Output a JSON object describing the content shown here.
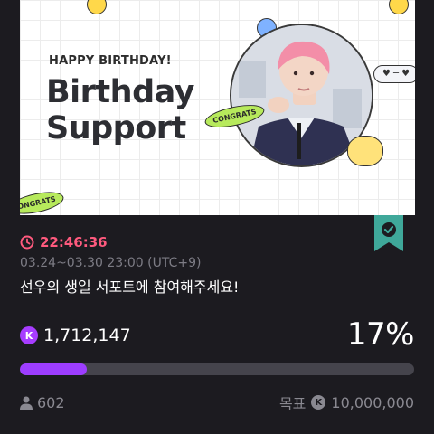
{
  "banner": {
    "greeting": "HAPPY BIRTHDAY!",
    "headline_line1": "Birthday",
    "headline_line2": "Support",
    "sticker_text": "CONGRATS",
    "sticker_text_partial": "GRATS",
    "sticker_text_bottom": "ONGRATS"
  },
  "event": {
    "countdown": "22:46:36",
    "period": "03.24~03.30 23:00 (UTC+9)",
    "title": "선우의 생일 서포트에 참여해주세요!",
    "coin_symbol": "K",
    "raised_amount": "1,712,147",
    "progress_percent": "17%",
    "progress_fraction": 0.17,
    "supporters": "602",
    "goal_label": "목표",
    "goal_amount": "10,000,000"
  },
  "colors": {
    "accent_purple": "#9d3dff",
    "timer_pink": "#ff5a7e",
    "badge_teal": "#3fa89a",
    "background": "#1c1b20"
  },
  "icons": {
    "timer": "clock-icon",
    "badge": "check-badge-icon",
    "supporters": "person-icon",
    "coin": "k-coin-icon"
  }
}
